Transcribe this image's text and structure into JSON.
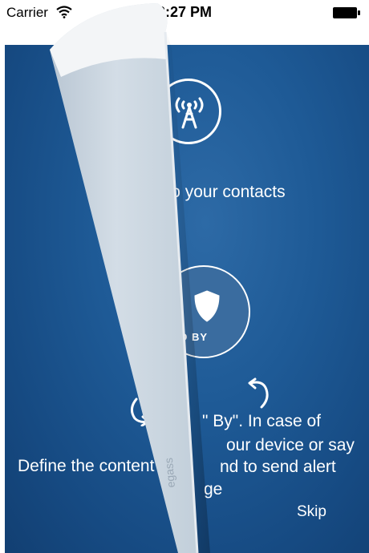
{
  "status_bar": {
    "carrier": "Carrier",
    "time": "2:27 PM"
  },
  "walkthrough": {
    "broadcast_text": "sage to your contacts",
    "shield_label": "D BY",
    "description_lines": [
      "\" By\". In case of",
      "our device or say",
      "nd to send alert",
      "ge"
    ],
    "define_text": "Define the content",
    "skip_label": "Skip",
    "curl_text": "egass"
  },
  "colors": {
    "background": "#1e5a96",
    "text": "#ffffff",
    "curl": "#c9d4de"
  },
  "icons": [
    "wifi-icon",
    "battery-icon",
    "radio-tower-icon",
    "shield-icon",
    "curve-arrow-left-icon",
    "curve-arrow-right-icon"
  ]
}
